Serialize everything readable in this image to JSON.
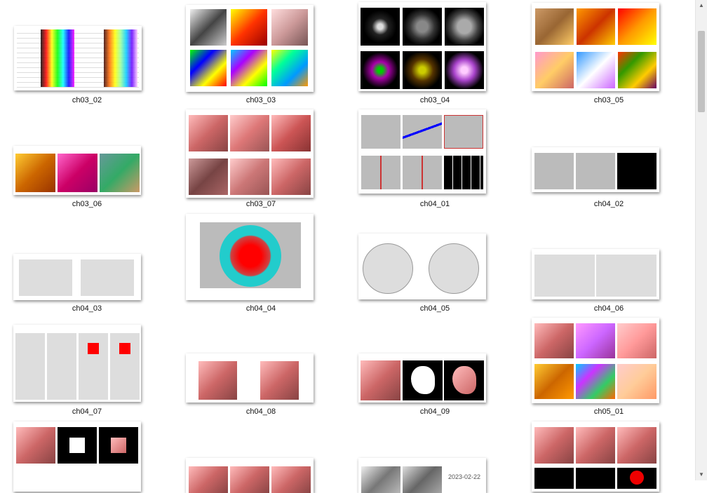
{
  "items": [
    {
      "label": "ch03_02"
    },
    {
      "label": "ch03_03"
    },
    {
      "label": "ch03_04"
    },
    {
      "label": "ch03_05"
    },
    {
      "label": "ch03_06"
    },
    {
      "label": "ch03_07"
    },
    {
      "label": "ch04_01"
    },
    {
      "label": "ch04_02"
    },
    {
      "label": "ch04_03"
    },
    {
      "label": "ch04_04"
    },
    {
      "label": "ch04_05"
    },
    {
      "label": "ch04_06"
    },
    {
      "label": "ch04_07"
    },
    {
      "label": "ch04_08"
    },
    {
      "label": "ch04_09"
    },
    {
      "label": "ch05_01"
    }
  ],
  "partial": {
    "watermark_date": "2023-02-22"
  },
  "scrollbar": {
    "up_icon": "chevron-up-icon",
    "down_icon": "chevron-down-icon"
  }
}
